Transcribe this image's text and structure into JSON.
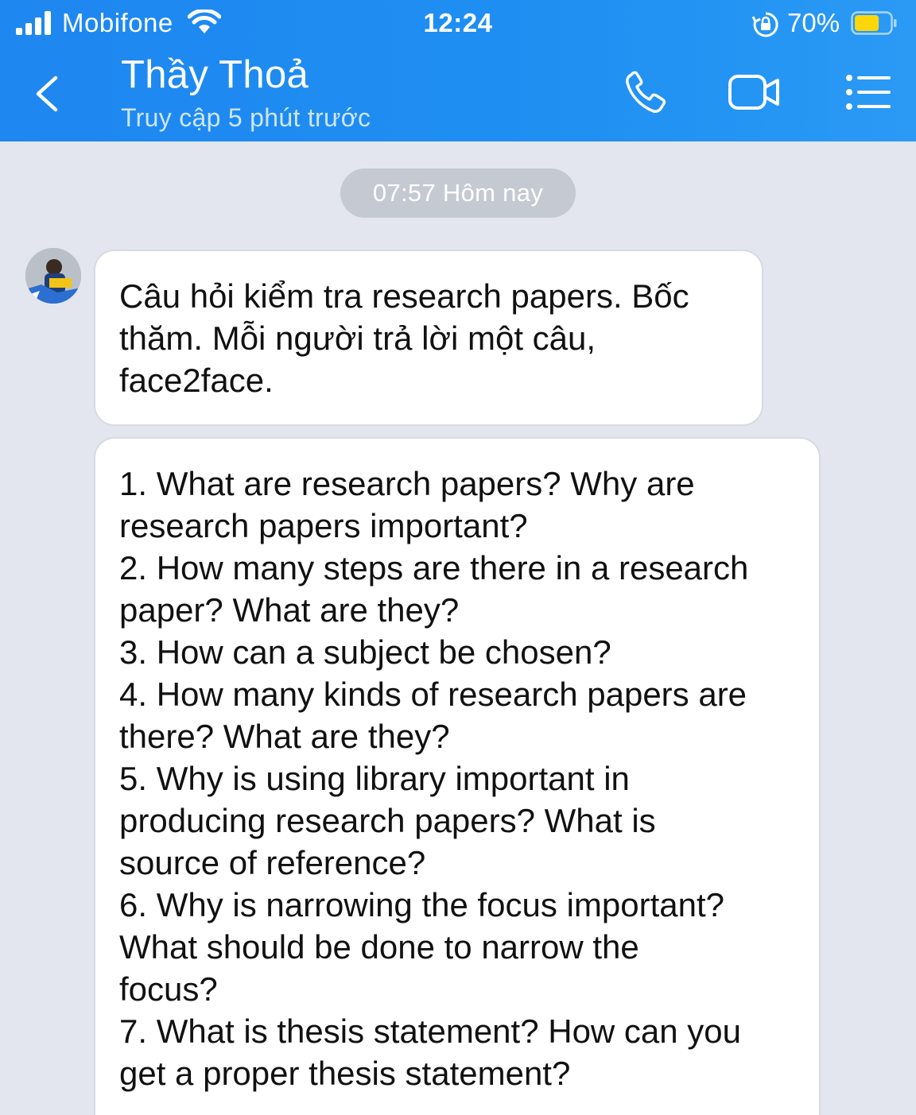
{
  "status_bar": {
    "carrier": "Mobifone",
    "time": "12:24",
    "battery_percent": "70%",
    "battery_level": 0.7,
    "battery_color": "#ffd60a"
  },
  "header": {
    "back_icon": "chevron-left-icon",
    "title": "Thầy Thoả",
    "subtitle": "Truy cập 5 phút trước",
    "actions": [
      "phone-icon",
      "video-camera-icon",
      "list-menu-icon"
    ],
    "accent_color": "#1e87f0"
  },
  "chat": {
    "date_separator": "07:57 Hôm nay",
    "messages": [
      {
        "sender": "Thầy Thoả",
        "lines": [
          "Câu hỏi kiểm tra research papers. Bốc",
          "thăm. Mỗi người trả lời một câu,",
          "face2face."
        ]
      },
      {
        "sender": "Thầy Thoả",
        "lines": [
          "1. What are research papers? Why are",
          "research papers important?",
          "2. How many steps are there in a research",
          "paper? What are they?",
          "3. How can a subject be chosen?",
          "4. How many kinds of research papers are",
          "there? What are they?",
          "5. Why is using library important in",
          "producing research papers? What is",
          "source of reference?",
          "6. Why is narrowing the focus important?",
          "What should be done to narrow the",
          "focus?",
          "7. What is thesis statement? How can you",
          "get a proper thesis statement?"
        ]
      }
    ]
  }
}
